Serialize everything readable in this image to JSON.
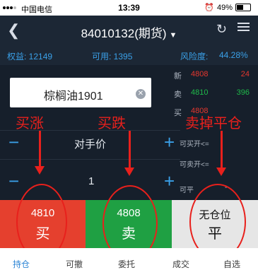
{
  "status_bar": {
    "carrier": "中国电信",
    "time": "13:39",
    "battery": "49%"
  },
  "header": {
    "title": "84010132(期货)"
  },
  "account": {
    "equity_label": "权益: 12149",
    "available_label": "可用: 1395",
    "risk_label": "风险度:",
    "risk_value": "44.28%"
  },
  "instrument": {
    "name": "棕榈油1901"
  },
  "quotes": [
    {
      "label": "新",
      "price": "4808",
      "volume": "24"
    },
    {
      "label": "卖",
      "price": "4810",
      "volume": "396"
    },
    {
      "label": "买",
      "price": "4808",
      "volume": ""
    }
  ],
  "order": {
    "price_type": "对手价",
    "quantity": "1"
  },
  "side_info": {
    "buy_open": "可买开<=",
    "sell_open": "可卖开<=",
    "close": "可平",
    "close_dash": "--"
  },
  "annotations": {
    "buy_up": "买涨",
    "buy_down": "买跌",
    "close_position": "卖掉平仓"
  },
  "actions": {
    "buy": {
      "price": "4810",
      "label": "买"
    },
    "sell": {
      "price": "4808",
      "label": "卖"
    },
    "close": {
      "price": "无仓位",
      "label": "平"
    }
  },
  "tabs": [
    "持仓",
    "可撤",
    "委托",
    "成交",
    "自选"
  ],
  "colors": {
    "bg_dark": "#161f2b",
    "buy": "#e5402e",
    "sell": "#1fa043",
    "accent_blue": "#3aa0e8",
    "annotation_red": "#e8201c"
  }
}
